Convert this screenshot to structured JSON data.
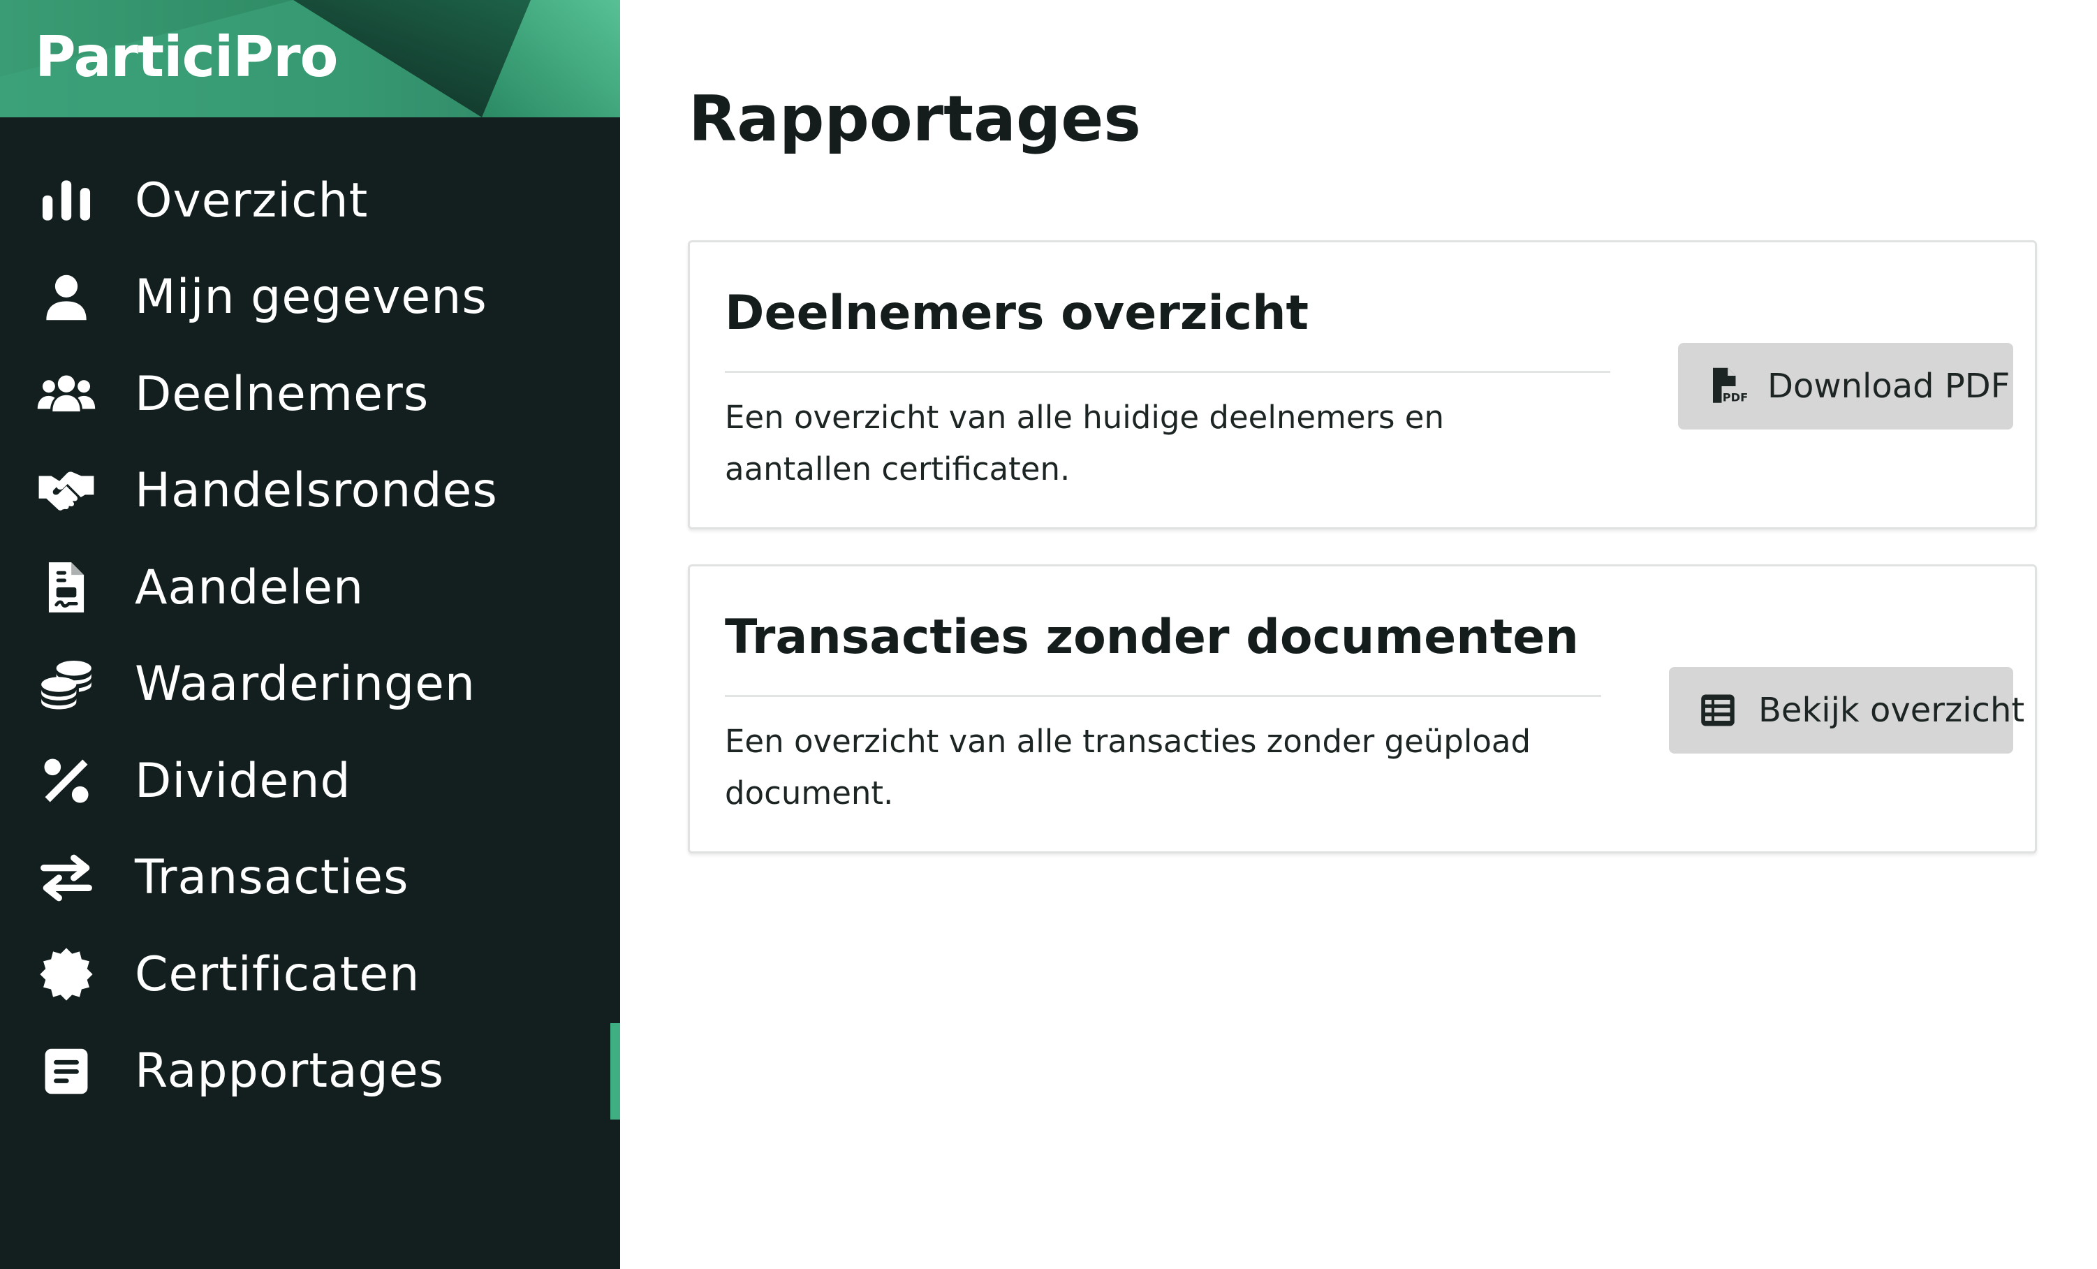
{
  "brand": {
    "name": "ParticiPro"
  },
  "colors": {
    "sidebar_bg": "#131e1e",
    "accent": "#3fae83",
    "button_bg": "#d6d6d6",
    "title_text": "#151c1c"
  },
  "sidebar": {
    "items": [
      {
        "label": "Overzicht",
        "icon": "bar-chart-icon",
        "active": false
      },
      {
        "label": "Mijn gegevens",
        "icon": "user-icon",
        "active": false
      },
      {
        "label": "Deelnemers",
        "icon": "users-icon",
        "active": false
      },
      {
        "label": "Handelsrondes",
        "icon": "handshake-icon",
        "active": false
      },
      {
        "label": "Aandelen",
        "icon": "file-contract-icon",
        "active": false
      },
      {
        "label": "Waarderingen",
        "icon": "coins-icon",
        "active": false
      },
      {
        "label": "Dividend",
        "icon": "percent-icon",
        "active": false
      },
      {
        "label": "Transacties",
        "icon": "exchange-arrows-icon",
        "active": false
      },
      {
        "label": "Certificaten",
        "icon": "certificate-icon",
        "active": false
      },
      {
        "label": "Rapportages",
        "icon": "report-icon",
        "active": true
      }
    ]
  },
  "main": {
    "title": "Rapportages",
    "reports": [
      {
        "title": "Deelnemers overzicht",
        "description": "Een overzicht van alle huidige deelnemers en aantallen certificaten.",
        "button": {
          "label": "Download PDF",
          "icon": "file-pdf-icon"
        }
      },
      {
        "title": "Transacties zonder documenten",
        "description": "Een overzicht van alle transacties zonder geüpload document.",
        "button": {
          "label": "Bekijk overzicht",
          "icon": "table-icon"
        }
      }
    ]
  }
}
